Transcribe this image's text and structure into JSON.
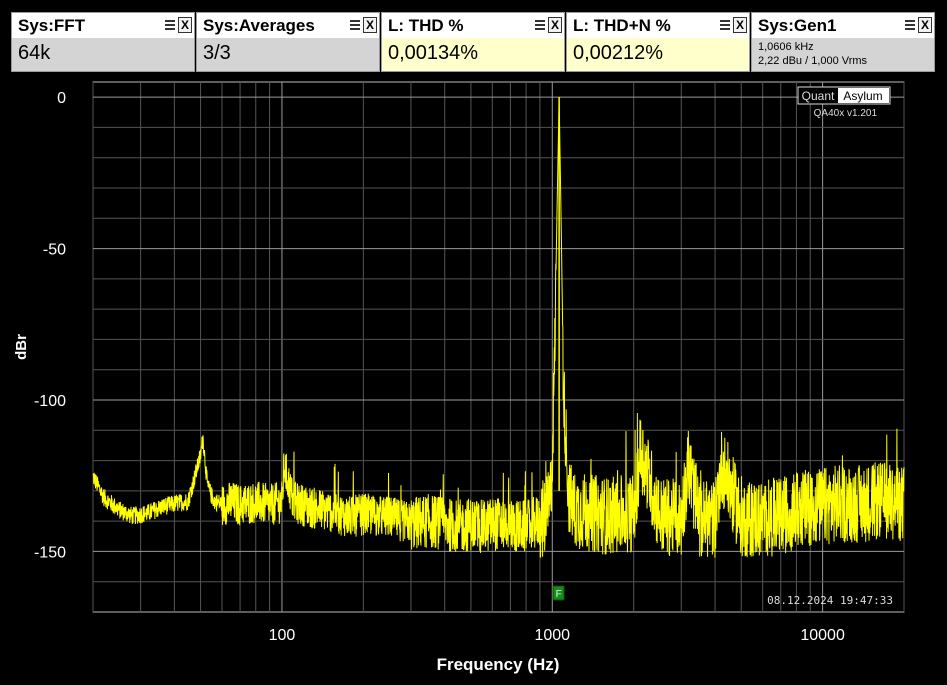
{
  "widgets": [
    {
      "title": "Sys:FFT",
      "value": "64k",
      "bg": "#d4d4d4"
    },
    {
      "title": "Sys:Averages",
      "value": "3/3",
      "bg": "#d4d4d4"
    },
    {
      "title": "L: THD %",
      "value": "0,00134%",
      "bg": "#ffffcc"
    },
    {
      "title": "L: THD+N %",
      "value": "0,00212%",
      "bg": "#ffffcc"
    },
    {
      "title": "Sys:Gen1",
      "line1": "1,0606 kHz",
      "line2": "2,22 dBu  / 1,000 Vrms",
      "bg": "#d4d4d4"
    }
  ],
  "logo": {
    "quant": "Quant",
    "asylum": "Asylum",
    "version": "QA40x v1.201"
  },
  "timestamp": "08.12.2024 19:47:33",
  "marker_label": "F",
  "chart_data": {
    "type": "line",
    "xlabel": "Frequency (Hz)",
    "ylabel": "dBr",
    "xscale": "log",
    "xlim": [
      20,
      20000
    ],
    "ylim": [
      -170,
      5
    ],
    "xticks": [
      {
        "v": 100,
        "label": "100"
      },
      {
        "v": 1000,
        "label": "1000"
      },
      {
        "v": 10000,
        "label": "10000"
      }
    ],
    "yticks": [
      {
        "v": 0,
        "label": "0"
      },
      {
        "v": -50,
        "label": "-50"
      },
      {
        "v": -100,
        "label": "-100"
      },
      {
        "v": -150,
        "label": "-150"
      }
    ],
    "grid": true,
    "series": [
      {
        "color": "#ffff00",
        "fundamental": {
          "x": 1060,
          "y": 0
        },
        "x": [
          20,
          22,
          25,
          28,
          32,
          36,
          40,
          45,
          50,
          51,
          53,
          56,
          60,
          65,
          70,
          80,
          90,
          100,
          102,
          110,
          130,
          150,
          180,
          200,
          250,
          300,
          350,
          400,
          450,
          500,
          550,
          600,
          650,
          700,
          750,
          800,
          850,
          900,
          950,
          980,
          1000,
          1020,
          1040,
          1060,
          1080,
          1100,
          1150,
          1200,
          1400,
          1600,
          2000,
          2120,
          2500,
          3000,
          3180,
          3500,
          4000,
          4240,
          5000,
          6000,
          7000,
          8000,
          9000,
          10000,
          11000,
          12000,
          14000,
          16000,
          18000,
          20000
        ],
        "y": [
          -125,
          -132,
          -136,
          -138,
          -137,
          -135,
          -134,
          -133,
          -118,
          -112,
          -128,
          -133,
          -134,
          -133,
          -134,
          -133,
          -134,
          -133,
          -121,
          -133,
          -135,
          -136,
          -138,
          -137,
          -138,
          -140,
          -139,
          -140,
          -141,
          -140,
          -141,
          -140,
          -140,
          -140,
          -141,
          -141,
          -140,
          -139,
          -137,
          -133,
          -118,
          -85,
          -40,
          0,
          -45,
          -95,
          -130,
          -135,
          -136,
          -137,
          -136,
          -115,
          -137,
          -138,
          -120,
          -138,
          -138,
          -120,
          -138,
          -138,
          -137,
          -135,
          -134,
          -134,
          -133,
          -133,
          -133,
          -132,
          -132,
          -133
        ]
      }
    ]
  }
}
